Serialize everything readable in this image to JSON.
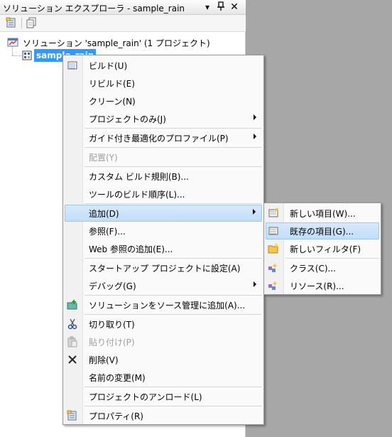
{
  "window": {
    "title": "ソリューション エクスプローラ - sample_rain",
    "pin_glyph": "ᕓ",
    "dropdown_glyph": "▾",
    "close_glyph": "✕"
  },
  "tree": {
    "solution_label": "ソリューション 'sample_rain' (1 プロジェクト)",
    "project_label": "sample_rain"
  },
  "context_menu": {
    "items": [
      {
        "label": "ビルド(U)"
      },
      {
        "label": "リビルド(E)"
      },
      {
        "label": "クリーン(N)"
      },
      {
        "label": "プロジェクトのみ(J)"
      },
      {
        "label": "ガイド付き最適化のプロファイル(P)"
      },
      {
        "label": "配置(Y)"
      },
      {
        "label": "カスタム ビルド規則(B)..."
      },
      {
        "label": "ツールのビルド順序(L)..."
      },
      {
        "label": "追加(D)"
      },
      {
        "label": "参照(F)..."
      },
      {
        "label": "Web 参照の追加(E)..."
      },
      {
        "label": "スタートアップ プロジェクトに設定(A)"
      },
      {
        "label": "デバッグ(G)"
      },
      {
        "label": "ソリューションをソース管理に追加(A)..."
      },
      {
        "label": "切り取り(T)"
      },
      {
        "label": "貼り付け(P)"
      },
      {
        "label": "削除(V)"
      },
      {
        "label": "名前の変更(M)"
      },
      {
        "label": "プロジェクトのアンロード(L)"
      },
      {
        "label": "プロパティ(R)"
      }
    ]
  },
  "submenu": {
    "items": [
      {
        "label": "新しい項目(W)..."
      },
      {
        "label": "既存の項目(G)..."
      },
      {
        "label": "新しいフィルタ(F)"
      },
      {
        "label": "クラス(C)..."
      },
      {
        "label": "リソース(R)..."
      }
    ]
  }
}
